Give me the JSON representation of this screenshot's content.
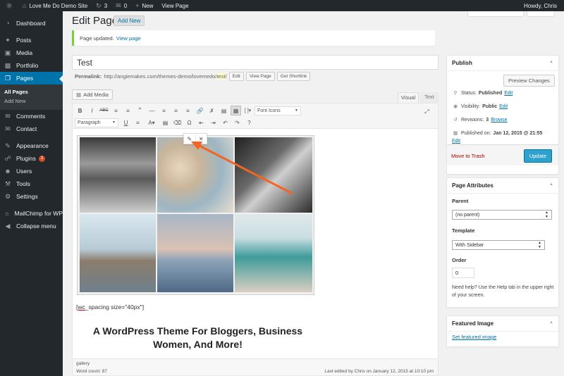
{
  "adminbar": {
    "site_name": "Love Me Do Demo Site",
    "updates_count": "3",
    "comments_count": "0",
    "new_label": "New",
    "view_page_label": "View Page",
    "howdy": "Howdy, Chris"
  },
  "sidebar": {
    "items": [
      {
        "label": "Dashboard",
        "icon": "dashboard-icon"
      },
      {
        "label": "Posts",
        "icon": "pin-icon"
      },
      {
        "label": "Media",
        "icon": "media-icon"
      },
      {
        "label": "Portfolio",
        "icon": "portfolio-icon"
      },
      {
        "label": "Pages",
        "icon": "pages-icon"
      },
      {
        "label": "Comments",
        "icon": "comments-icon"
      },
      {
        "label": "Contact",
        "icon": "contact-icon"
      },
      {
        "label": "Appearance",
        "icon": "appearance-icon"
      },
      {
        "label": "Plugins",
        "icon": "plugins-icon",
        "badge": "3"
      },
      {
        "label": "Users",
        "icon": "users-icon"
      },
      {
        "label": "Tools",
        "icon": "tools-icon"
      },
      {
        "label": "Settings",
        "icon": "settings-icon"
      },
      {
        "label": "MailChimp for WP",
        "icon": "mailchimp-icon"
      },
      {
        "label": "Collapse menu",
        "icon": "collapse-icon"
      }
    ],
    "submenu": [
      "All Pages",
      "Add New"
    ]
  },
  "header": {
    "title": "Edit Page",
    "add_new": "Add New"
  },
  "notice": {
    "text": "Page updated.",
    "link": "View page"
  },
  "post": {
    "title": "Test",
    "permalink_label": "Permalink:",
    "permalink_base": "http://angiemakes.com/themes-demo/lovemedo/",
    "permalink_slug": "test",
    "permalink_end": "/",
    "edit_btn": "Edit",
    "view_page_btn": "View Page",
    "shortlink_btn": "Get Shortlink"
  },
  "editor": {
    "add_media": "Add Media",
    "tab_visual": "Visual",
    "tab_text": "Text",
    "font_select": "Font Icons",
    "format_select": "Paragraph",
    "shortcode": "[wc_spacing size=\"40px\"]",
    "shortcode_prefix": "[",
    "shortcode_word": "wc",
    "shortcode_rest": "_spacing size=\"40px\"]",
    "heading_line1": "A WordPress Theme For Bloggers, Business",
    "heading_line2": "Women, And More!",
    "path": "gallery",
    "word_count": "Word count: 87",
    "last_edited": "Last edited by Chris on January 12, 2015 at 10:10 pm"
  },
  "publish": {
    "title": "Publish",
    "preview": "Preview Changes",
    "status_label": "Status:",
    "status_value": "Published",
    "status_edit": "Edit",
    "visibility_label": "Visibility:",
    "visibility_value": "Public",
    "visibility_edit": "Edit",
    "revisions_label": "Revisions:",
    "revisions_value": "3",
    "revisions_link": "Browse",
    "published_label": "Published on:",
    "published_value": "Jan 12, 2015 @ 21:55",
    "published_edit": "Edit",
    "trash": "Move to Trash",
    "update": "Update"
  },
  "page_attributes": {
    "title": "Page Attributes",
    "parent_label": "Parent",
    "parent_value": "(no parent)",
    "template_label": "Template",
    "template_value": "With Sidebar",
    "order_label": "Order",
    "order_value": "0",
    "help": "Need help? Use the Help tab in the upper right of your screen."
  },
  "featured_image": {
    "title": "Featured Image",
    "link": "Set featured image"
  },
  "colors": {
    "admin_dark": "#23282d",
    "accent": "#0073aa",
    "update_button": "#2ea2cc",
    "annotation_arrow": "#f26522"
  }
}
